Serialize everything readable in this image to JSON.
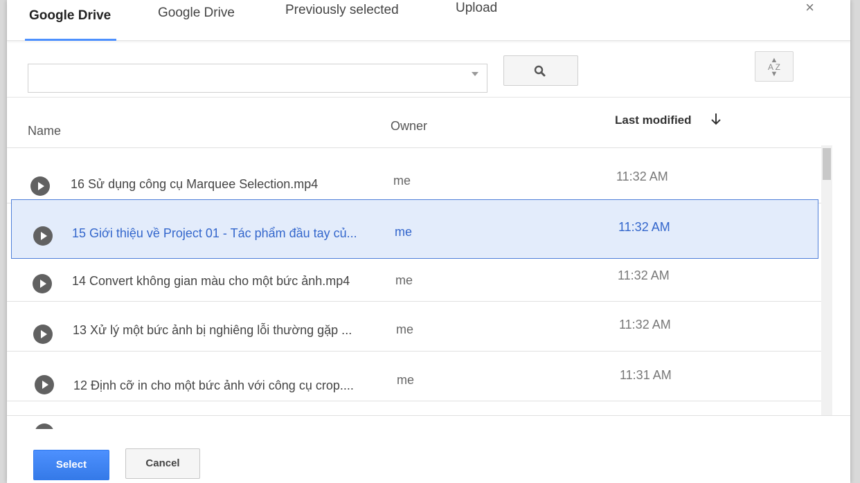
{
  "tabs": [
    {
      "label": "Google Drive",
      "active": true
    },
    {
      "label": "Google Drive",
      "active": false
    },
    {
      "label": "Previously selected",
      "active": false
    },
    {
      "label": "Upload",
      "active": false
    }
  ],
  "close_label": "×",
  "search": {
    "value": "",
    "placeholder": ""
  },
  "sort_icon": {
    "top": "▲",
    "label": "A Z",
    "bottom": "▼"
  },
  "columns": {
    "name": "Name",
    "owner": "Owner",
    "last_modified": "Last modified"
  },
  "files": [
    {
      "name": "16 Sử dụng công cụ Marquee Selection.mp4",
      "owner": "me",
      "modified": "11:32 AM",
      "selected": false
    },
    {
      "name": "15 Giới thiệu về Project 01 - Tác phẩm đầu tay củ...",
      "owner": "me",
      "modified": "11:32 AM",
      "selected": true
    },
    {
      "name": "14 Convert không gian màu cho một bức ảnh.mp4",
      "owner": "me",
      "modified": "11:32 AM",
      "selected": false
    },
    {
      "name": "13 Xử lý một bức ảnh bị nghiêng lỗi thường gặp ...",
      "owner": "me",
      "modified": "11:32 AM",
      "selected": false
    },
    {
      "name": "12 Định cỡ in cho một bức ảnh với công cụ crop....",
      "owner": "me",
      "modified": "11:31 AM",
      "selected": false
    }
  ],
  "footer": {
    "select_label": "Select",
    "cancel_label": "Cancel"
  },
  "colors": {
    "accent": "#4d90fe",
    "selected_bg": "#e3ecfb",
    "selected_text": "#3366cc"
  }
}
